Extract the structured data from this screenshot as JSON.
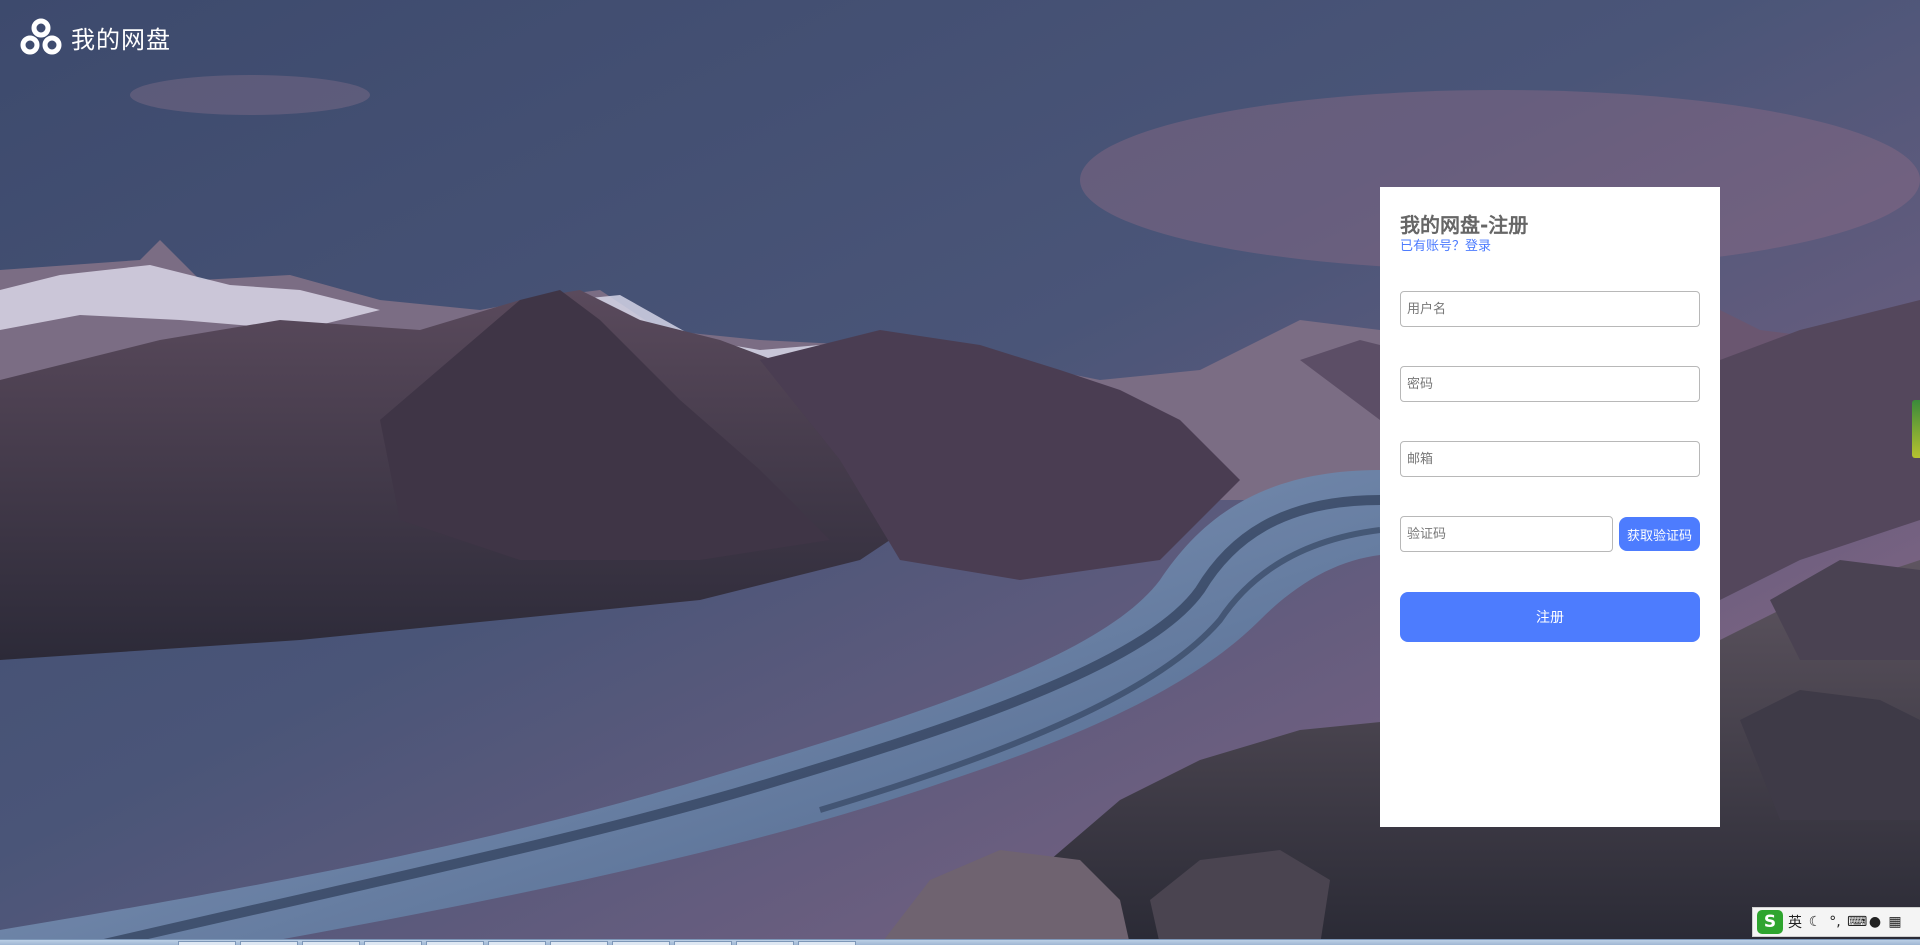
{
  "brand": {
    "logo_icon": "cloud-disk-logo-icon",
    "name": "我的网盘"
  },
  "register": {
    "title": "我的网盘-注册",
    "login_link": "已有账号？登录",
    "username_placeholder": "用户名",
    "password_placeholder": "密码",
    "email_placeholder": "邮箱",
    "code_placeholder": "验证码",
    "get_code_label": "获取验证码",
    "submit_label": "注册"
  },
  "ime": {
    "logo": "S",
    "mode_label": "英",
    "items": [
      "moon-icon",
      "punctuation-icon",
      "keyboard-icon",
      "user-icon",
      "grid-icon"
    ]
  },
  "colors": {
    "accent": "#4d7cfe",
    "panel_bg": "#ffffff",
    "title_text": "#666666"
  }
}
